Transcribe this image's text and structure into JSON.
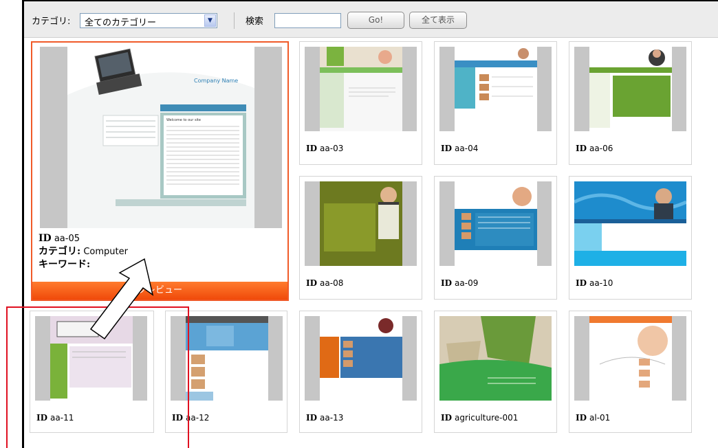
{
  "toolbar": {
    "category_label": "カテゴリ:",
    "category_value": "全てのカテゴリー",
    "search_label": "検索",
    "search_value": "",
    "go_label": "Go!",
    "show_all_label": "全て表示"
  },
  "featured": {
    "id_label": "ID",
    "id": "aa-05",
    "category_label": "カテゴリ:",
    "category": "Computer",
    "keyword_label": "キーワード:",
    "keyword": "",
    "preview_label": "プレビュー",
    "thumb_title": "Company Name",
    "thumb_welcome": "Welcome to our site"
  },
  "templates": [
    {
      "id_label": "ID",
      "id": "aa-03"
    },
    {
      "id_label": "ID",
      "id": "aa-04"
    },
    {
      "id_label": "ID",
      "id": "aa-06"
    },
    {
      "id_label": "ID",
      "id": "aa-08"
    },
    {
      "id_label": "ID",
      "id": "aa-09"
    },
    {
      "id_label": "ID",
      "id": "aa-10"
    },
    {
      "id_label": "ID",
      "id": "aa-11"
    },
    {
      "id_label": "ID",
      "id": "aa-12"
    },
    {
      "id_label": "ID",
      "id": "aa-13"
    },
    {
      "id_label": "ID",
      "id": "agriculture-001"
    },
    {
      "id_label": "ID",
      "id": "al-01"
    }
  ],
  "colors": {
    "accent_orange": "#f05a28",
    "annotation_red": "#e01020"
  }
}
